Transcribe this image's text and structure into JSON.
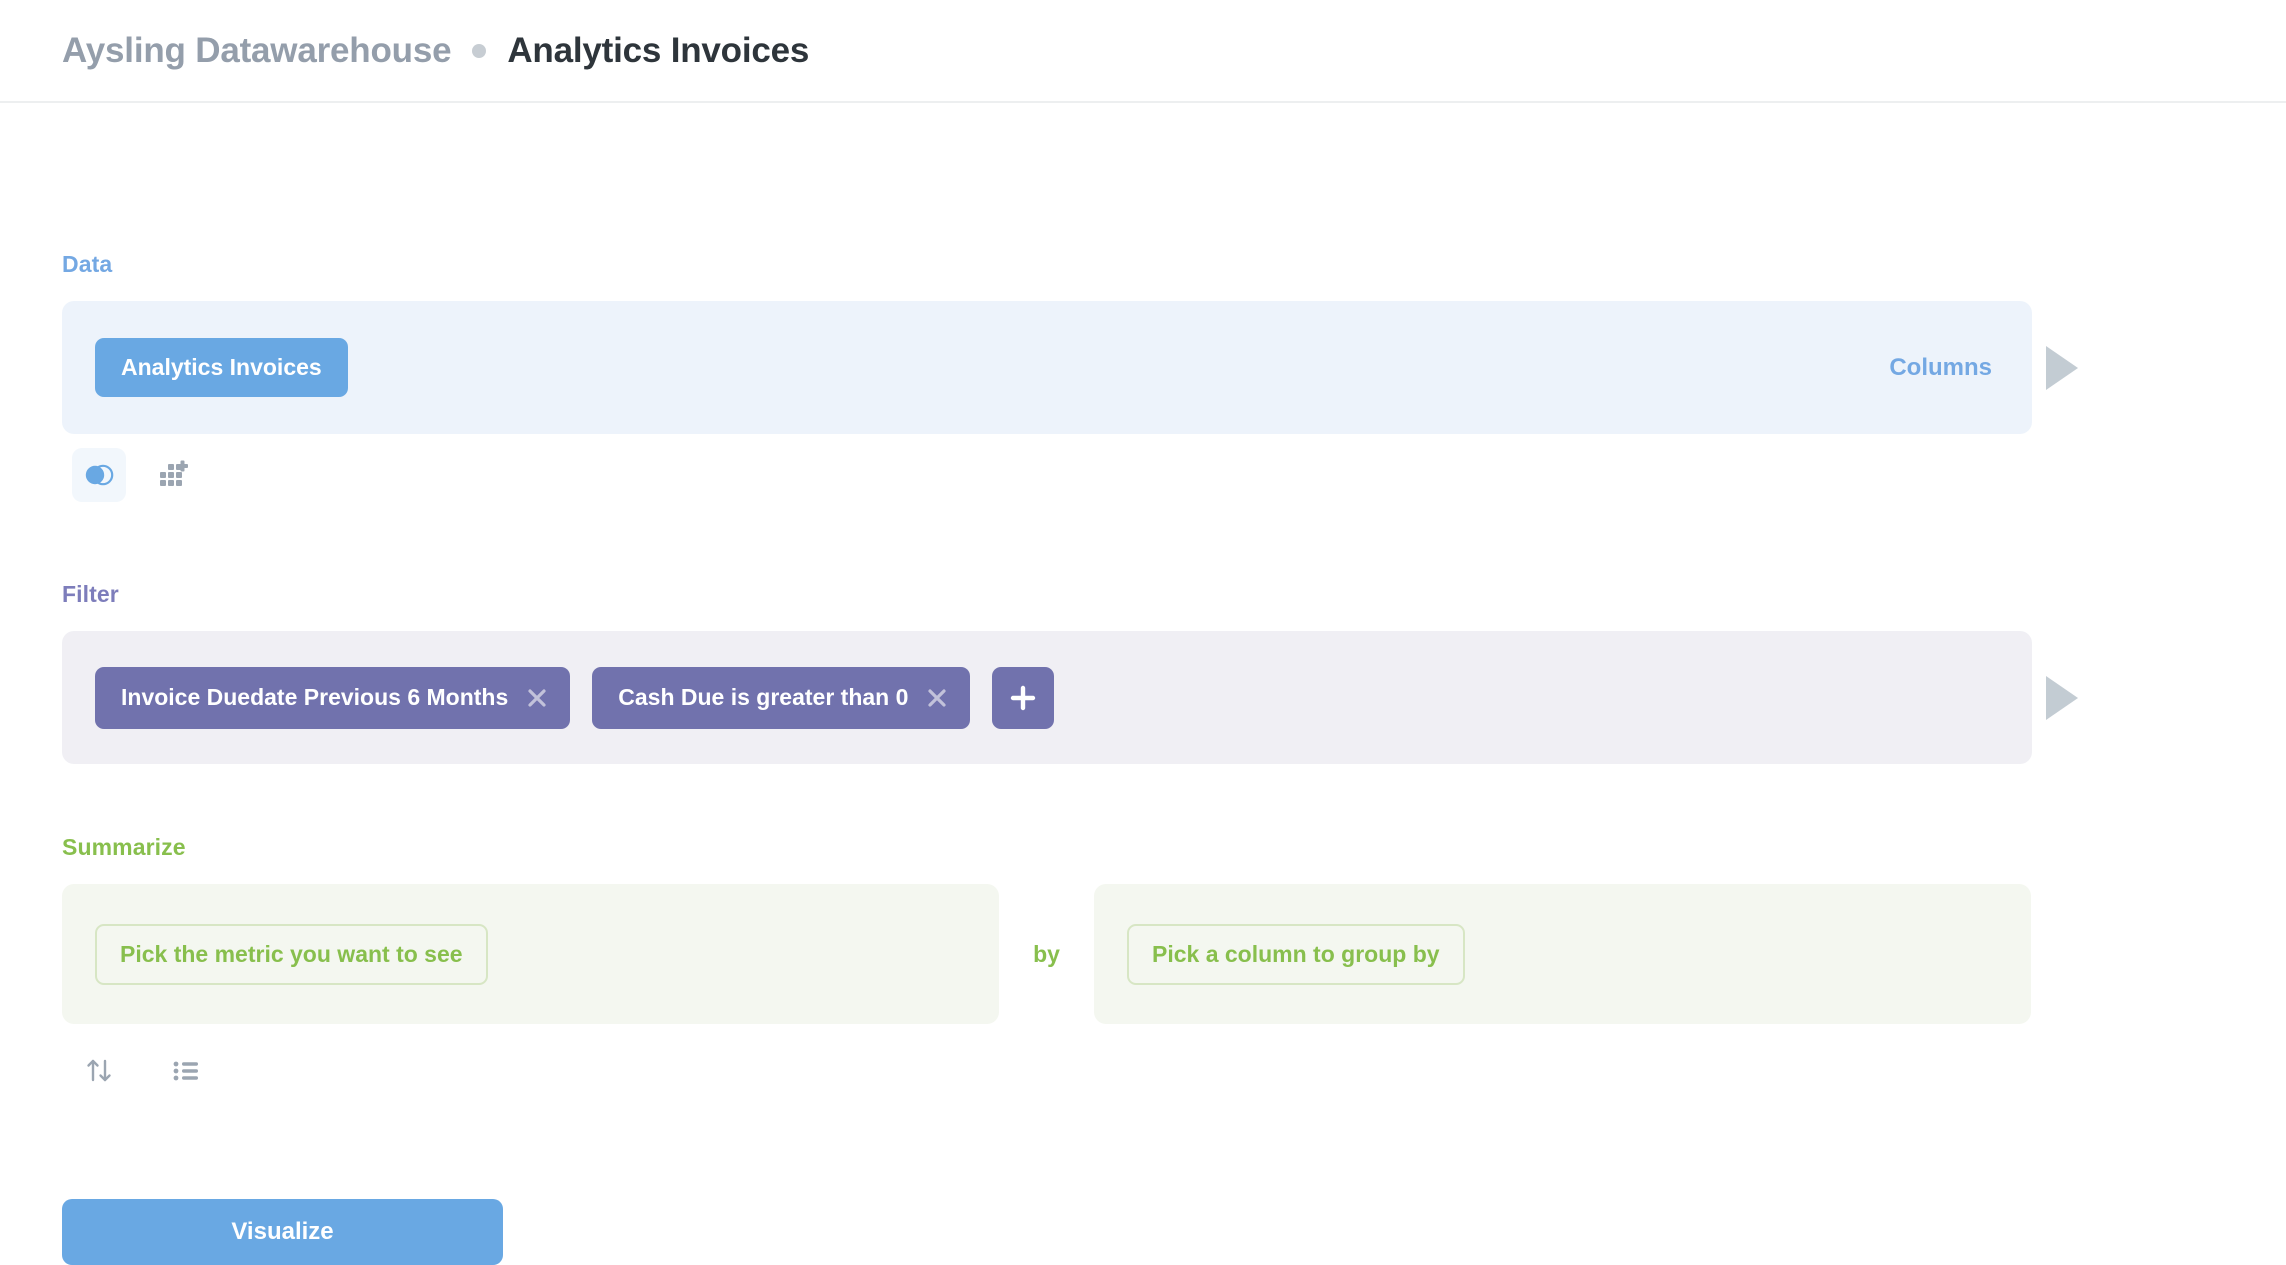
{
  "header": {
    "source_label": "Aysling Datawarehouse",
    "separator": "dot-separator",
    "title": "Analytics Invoices"
  },
  "steps": {
    "data": {
      "label": "Data",
      "table_pill": "Analytics Invoices",
      "columns_link": "Columns",
      "run_icon": "play-icon",
      "actions": [
        {
          "icon": "join-data-icon",
          "active": true
        },
        {
          "icon": "custom-column-icon",
          "active": false
        }
      ]
    },
    "filter": {
      "label": "Filter",
      "chips": [
        {
          "text": "Invoice Duedate Previous 6 Months",
          "remove_icon": "close-icon"
        },
        {
          "text": "Cash Due is greater than 0",
          "remove_icon": "close-icon"
        }
      ],
      "add_icon": "plus-icon",
      "run_icon": "play-icon"
    },
    "summarize": {
      "label": "Summarize",
      "metric_placeholder": "Pick the metric you want to see",
      "by_label": "by",
      "breakout_placeholder": "Pick a column to group by",
      "actions": [
        {
          "icon": "sort-icon"
        },
        {
          "icon": "row-limit-icon"
        }
      ]
    }
  },
  "footer": {
    "visualize_label": "Visualize"
  },
  "colors": {
    "data_accent": "#74A8E3",
    "data_pill": "#69A8E3",
    "data_panel_bg": "#EDF3FB",
    "filter_accent": "#7D7DBB",
    "filter_chip": "#7172AD",
    "filter_panel_bg": "#F0EFF4",
    "summarize_accent": "#88BF4D",
    "summarize_panel_bg": "#F4F7F0",
    "title_text": "#2E353B",
    "muted_text": "#949EAB",
    "icon_gray": "#9BA5B1",
    "run_arrow": "#C3CCD3"
  }
}
